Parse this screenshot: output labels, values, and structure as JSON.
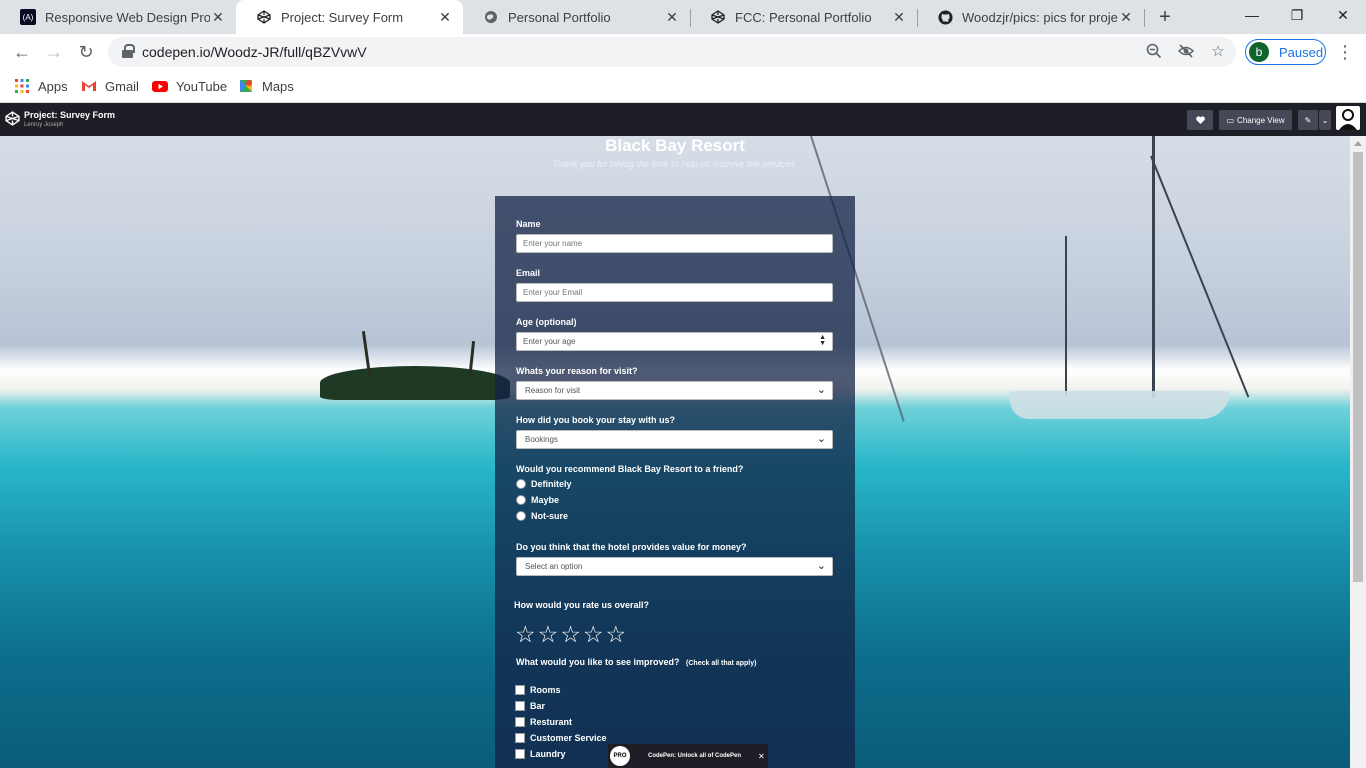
{
  "tabs": [
    {
      "label": "Responsive Web Design Projec",
      "icon": "freecodecamp-icon",
      "active": false
    },
    {
      "label": "Project: Survey Form",
      "icon": "codepen-icon",
      "active": true
    },
    {
      "label": "Personal Portfolio",
      "icon": "globe-icon",
      "active": false
    },
    {
      "label": "FCC: Personal Portfolio",
      "icon": "codepen-icon",
      "active": false
    },
    {
      "label": "Woodzjr/pics: pics for project",
      "icon": "github-icon",
      "active": false
    }
  ],
  "toolbar": {
    "url": "codepen.io/Woodz-JR/full/qBZVvwV",
    "profile_initial": "b",
    "profile_status": "Paused"
  },
  "bookmarks": [
    {
      "label": "Apps",
      "icon": "apps-grid-icon"
    },
    {
      "label": "Gmail",
      "icon": "gmail-icon"
    },
    {
      "label": "YouTube",
      "icon": "youtube-icon"
    },
    {
      "label": "Maps",
      "icon": "maps-icon"
    }
  ],
  "codepen": {
    "title": "Project: Survey Form",
    "author": "Lenroy Joseph",
    "change_view": "Change View"
  },
  "page": {
    "title": "Black Bay Resort",
    "subtitle": "Thank you for taking the time to help us improve the services."
  },
  "form": {
    "name_label": "Name",
    "name_placeholder": "Enter your name",
    "email_label": "Email",
    "email_placeholder": "Enter your Email",
    "age_label": "Age (optional)",
    "age_placeholder": "Enter your age",
    "reason_label": "Whats your reason for visit?",
    "reason_value": "Reason for visit",
    "booking_label": "How did you book your stay with us?",
    "booking_value": "Bookings",
    "recommend_label": "Would you recommend Black Bay Resort to a friend?",
    "recommend_options": [
      "Definitely",
      "Maybe",
      "Not-sure"
    ],
    "value_label": "Do you think that the hotel provides value for money?",
    "value_value": "Select an option",
    "rating_label": "How would you rate us overall?",
    "rating_stars": 5,
    "improve_label": "What would you like to see improved?",
    "improve_hint": "(Check all that apply)",
    "improve_options": [
      "Rooms",
      "Bar",
      "Resturant",
      "Customer Service",
      "Laundry"
    ]
  },
  "promo": {
    "text": "CodePen: Unlock all of CodePen",
    "badge": "PRO"
  }
}
